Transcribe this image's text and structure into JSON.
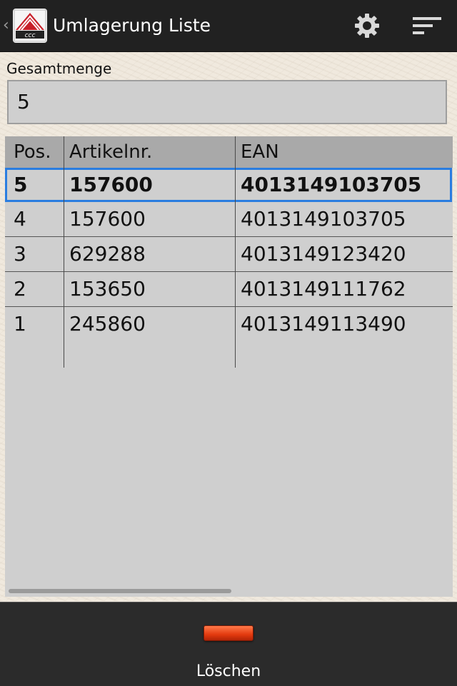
{
  "actionbar": {
    "title": "Umlagerung Liste",
    "icons": [
      "back-caret-icon",
      "app-logo-icon",
      "settings-gear-icon",
      "overflow-menu-icon"
    ]
  },
  "total": {
    "label": "Gesamtmenge",
    "value": "5"
  },
  "table": {
    "columns": [
      "Pos.",
      "Artikelnr.",
      "EAN"
    ],
    "rows": [
      {
        "pos": "5",
        "article": "157600",
        "ean": "4013149103705",
        "selected": true
      },
      {
        "pos": "4",
        "article": "157600",
        "ean": "4013149103705"
      },
      {
        "pos": "3",
        "article": "629288",
        "ean": "4013149123420"
      },
      {
        "pos": "2",
        "article": "153650",
        "ean": "4013149111762"
      },
      {
        "pos": "1",
        "article": "245860",
        "ean": "4013149113490"
      }
    ]
  },
  "bottom": {
    "delete_label": "Löschen",
    "delete_icon": "red-delete-bar-icon"
  },
  "colors": {
    "actionbar": "#212121",
    "selection": "#2a7de0",
    "table_bg": "#cfcfcf",
    "header_bg": "#a9a9a9",
    "delete_red": "#e33a0f"
  }
}
